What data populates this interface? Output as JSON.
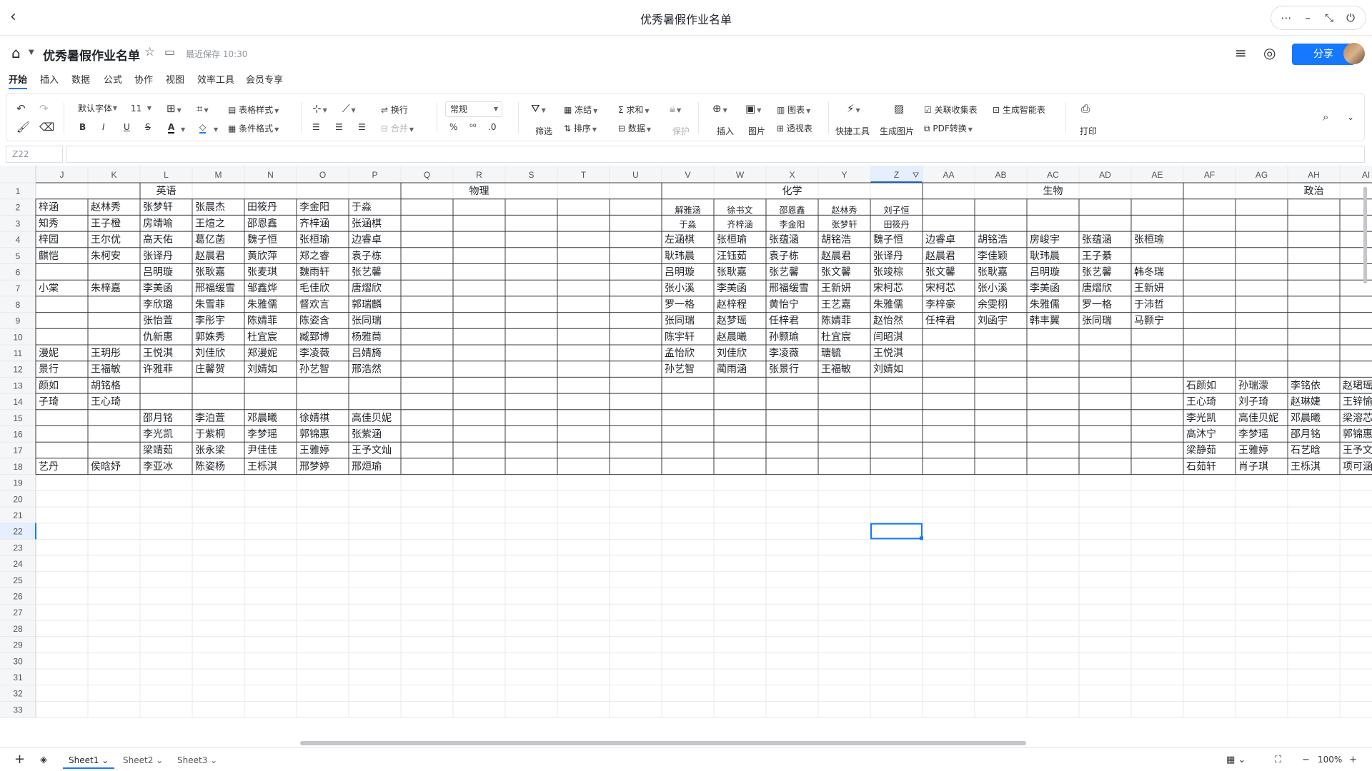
{
  "window": {
    "title": "优秀暑假作业名单"
  },
  "doc": {
    "name": "优秀暑假作业名单",
    "saved": "最近保存 10:30",
    "share_label": "分享"
  },
  "menu_tabs": [
    "开始",
    "插入",
    "数据",
    "公式",
    "协作",
    "视图",
    "效率工具",
    "会员专享"
  ],
  "toolbar": {
    "font": "默认字体",
    "size": "11",
    "table_style": "表格样式",
    "cond_format": "条件格式",
    "wrap": "换行",
    "merge": "合并",
    "number_format": "常规",
    "decimals": ".0",
    "filter": "筛选",
    "freeze": "冻结",
    "sort": "排序",
    "sum": "求和",
    "data": "数据",
    "protect": "保护",
    "insert": "插入",
    "image": "图片",
    "chart": "图表",
    "pivot": "透视表",
    "quick_tools": "快捷工具",
    "gen_image": "生成图片",
    "linked_collect": "关联收集表",
    "smart_table": "生成智能表",
    "pdf": "PDF转换",
    "print": "打印"
  },
  "name_box": "Z22",
  "columns": [
    "J",
    "K",
    "L",
    "M",
    "N",
    "O",
    "P",
    "Q",
    "R",
    "S",
    "T",
    "U",
    "V",
    "W",
    "X",
    "Y",
    "Z",
    "AA",
    "AB",
    "AC",
    "AD",
    "AE",
    "AF",
    "AG",
    "AH",
    "AI"
  ],
  "row_numbers": [
    1,
    2,
    3,
    4,
    5,
    6,
    7,
    8,
    9,
    10,
    11,
    12,
    13,
    14,
    15,
    16,
    17,
    18,
    19,
    20,
    21,
    22,
    23,
    24,
    25,
    26,
    27,
    28,
    29,
    30,
    31,
    32,
    33
  ],
  "subject_headers": {
    "L": "英语",
    "R": "物理",
    "X": "化学",
    "AC": "生物",
    "AH": "政治"
  },
  "cells": [
    [
      "梓涵",
      "赵林秀",
      "张梦轩",
      "张晨杰",
      "田筱丹",
      "李金阳",
      "于淼",
      "",
      "",
      "",
      "",
      "",
      "",
      "",
      "",
      "",
      "",
      "",
      "",
      "",
      "",
      "",
      "",
      "",
      "",
      ""
    ],
    [
      "知秀",
      "王子橙",
      "房靖喻",
      "王煊之",
      "邵恩鑫",
      "齐梓涵",
      "张涵棋",
      "",
      "",
      "",
      "",
      "",
      "",
      "",
      "",
      "",
      "",
      "",
      "",
      "",
      "",
      "",
      "",
      "",
      "",
      ""
    ],
    [
      "梓园",
      "王尔优",
      "高天佑",
      "葛亿菡",
      "魏子恒",
      "张桓瑜",
      "边睿卓",
      "",
      "",
      "",
      "",
      "",
      "左涵棋",
      "张桓瑜",
      "张蕴涵",
      "胡铭浩",
      "魏子恒",
      "边睿卓",
      "胡铭浩",
      "房峻宇",
      "张蕴涵",
      "张桓瑜",
      "",
      "",
      "",
      ""
    ],
    [
      "麒恺",
      "朱柯安",
      "张译丹",
      "赵晨君",
      "黄欣萍",
      "郑之睿",
      "袁子栋",
      "",
      "",
      "",
      "",
      "",
      "耿玮晨",
      "汪钰茹",
      "袁子栋",
      "赵晨君",
      "张译丹",
      "赵晨君",
      "李佳颖",
      "耿玮晨",
      "王子綦",
      "",
      "",
      "",
      "",
      ""
    ],
    [
      "",
      "",
      "吕明璇",
      "张耿嘉",
      "张麦琪",
      "魏雨轩",
      "张艺馨",
      "",
      "",
      "",
      "",
      "",
      "吕明璇",
      "张耿嘉",
      "张艺馨",
      "张文馨",
      "张竣棕",
      "张文馨",
      "张耿嘉",
      "吕明璇",
      "张艺馨",
      "韩冬瑞",
      "",
      "",
      "",
      ""
    ],
    [
      "小棠",
      "朱梓嘉",
      "李美函",
      "邢福缓雪",
      "邹鑫烨",
      "毛佳欣",
      "唐熠欣",
      "",
      "",
      "",
      "",
      "",
      "张小溪",
      "李美函",
      "邢福缓雪",
      "王新妍",
      "宋柯芯",
      "宋柯芯",
      "张小溪",
      "李美函",
      "唐熠欣",
      "王新妍",
      "",
      "",
      "",
      ""
    ],
    [
      "",
      "",
      "李欣璐",
      "朱雪菲",
      "朱雅儒",
      "督欢言",
      "郭瑞麟",
      "",
      "",
      "",
      "",
      "",
      "罗一格",
      "赵梓程",
      "黄怡宁",
      "王艺嘉",
      "朱雅儒",
      "李梓豪",
      "余雯栩",
      "朱雅儒",
      "罗一格",
      "于沛哲",
      "",
      "",
      "",
      ""
    ],
    [
      "",
      "",
      "张怡萱",
      "李彤宇",
      "陈婧菲",
      "陈姿含",
      "张同瑞",
      "",
      "",
      "",
      "",
      "",
      "张同瑞",
      "赵梦瑶",
      "任梓君",
      "陈婧菲",
      "赵怡然",
      "任梓君",
      "刘函宇",
      "韩丰翼",
      "张同瑞",
      "马颢宁",
      "",
      "",
      "",
      ""
    ],
    [
      "",
      "",
      "仇新惠",
      "郭姝秀",
      "杜宜宸",
      "臧郅博",
      "杨雅茼",
      "",
      "",
      "",
      "",
      "",
      "陈宇轩",
      "赵晨曦",
      "孙颢瑜",
      "杜宜宸",
      "闫昭淇",
      "",
      "",
      "",
      "",
      "",
      "",
      "",
      "",
      ""
    ],
    [
      "漫妮",
      "王玥彤",
      "王悦淇",
      "刘佳欣",
      "郑漫妮",
      "李凌薇",
      "吕婧旖",
      "",
      "",
      "",
      "",
      "",
      "孟怡欣",
      "刘佳欣",
      "李凌薇",
      "瑭毓",
      "王悦淇",
      "",
      "",
      "",
      "",
      "",
      "",
      "",
      "",
      ""
    ],
    [
      "景行",
      "王福敏",
      "许雅菲",
      "庄馨贺",
      "刘婧如",
      "孙艺智",
      "邢浩然",
      "",
      "",
      "",
      "",
      "",
      "孙艺智",
      "蔺雨涵",
      "张景行",
      "王福敏",
      "刘婧如",
      "",
      "",
      "",
      "",
      "",
      "",
      "",
      "",
      ""
    ],
    [
      "颜如",
      "胡铭格",
      "",
      "",
      "",
      "",
      "",
      "",
      "",
      "",
      "",
      "",
      "",
      "",
      "",
      "",
      "",
      "",
      "",
      "",
      "",
      "",
      "石颜如",
      "孙瑞濛",
      "李铭依",
      "赵珺瑶"
    ],
    [
      "子琦",
      "王心琦",
      "",
      "",
      "",
      "",
      "",
      "",
      "",
      "",
      "",
      "",
      "",
      "",
      "",
      "",
      "",
      "",
      "",
      "",
      "",
      "",
      "王心琦",
      "刘子琦",
      "赵琳婕",
      "王锌愉"
    ],
    [
      "",
      "",
      "邵月铭",
      "李泊萱",
      "邓晨曦",
      "徐婧祺",
      "高佳贝妮",
      "",
      "",
      "",
      "",
      "",
      "",
      "",
      "",
      "",
      "",
      "",
      "",
      "",
      "",
      "",
      "李光凯",
      "高佳贝妮",
      "邓晨曦",
      "梁溶芯"
    ],
    [
      "",
      "",
      "李光凯",
      "于紫桐",
      "李梦瑶",
      "郭锦惠",
      "张紫涵",
      "",
      "",
      "",
      "",
      "",
      "",
      "",
      "",
      "",
      "",
      "",
      "",
      "",
      "",
      "",
      "高沐宁",
      "李梦瑶",
      "邵月铭",
      "郭锦惠"
    ],
    [
      "",
      "",
      "梁靖茹",
      "张永梁",
      "尹佳佳",
      "王雅婷",
      "王予文灿",
      "",
      "",
      "",
      "",
      "",
      "",
      "",
      "",
      "",
      "",
      "",
      "",
      "",
      "",
      "",
      "梁静茹",
      "王雅婷",
      "石艺晗",
      "王予文灿"
    ],
    [
      "艺丹",
      "侯晗妤",
      "李亚冰",
      "陈姿杨",
      "王栎淇",
      "邢梦婷",
      "邢烜瑜",
      "",
      "",
      "",
      "",
      "",
      "",
      "",
      "",
      "",
      "",
      "",
      "",
      "",
      "",
      "",
      "石茹轩",
      "肖子琪",
      "王栎淇",
      "项可涵"
    ]
  ],
  "chem_row2_top": [
    "解雅涵",
    "徐书文",
    "邵恩鑫",
    "赵林秀",
    "刘子恒"
  ],
  "chem_row3_top": [
    "于淼",
    "齐梓涵",
    "李金阳",
    "张梦轩",
    "田筱丹"
  ],
  "sheets": [
    "Sheet1",
    "Sheet2",
    "Sheet3"
  ],
  "zoom": "100%"
}
